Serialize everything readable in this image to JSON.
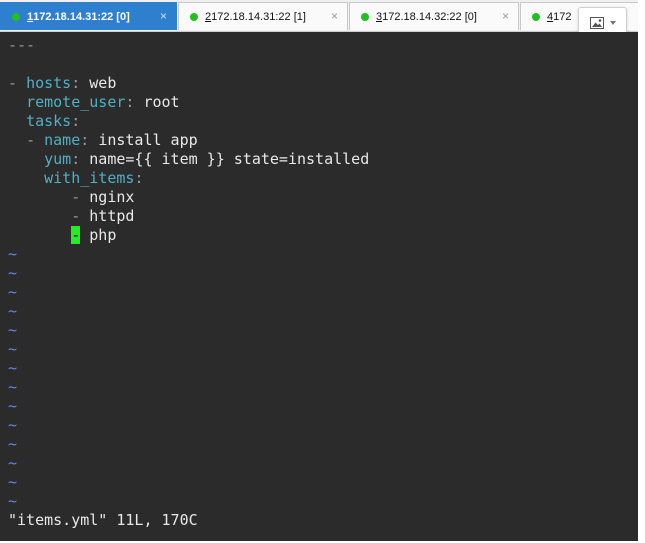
{
  "tabs": [
    {
      "num": "1",
      "label": " 172.18.14.31:22 [0]",
      "active": true,
      "close": "×"
    },
    {
      "num": "2",
      "label": " 172.18.14.31:22 [1]",
      "active": false,
      "close": "×"
    },
    {
      "num": "3",
      "label": " 172.18.14.32:22 [0]",
      "active": false,
      "close": "×"
    },
    {
      "num": "4",
      "label": " 172",
      "active": false,
      "close": ""
    }
  ],
  "media_button": {
    "icon": "image-icon"
  },
  "editor": {
    "lines": [
      {
        "parts": [
          {
            "t": "---",
            "c": "d"
          }
        ]
      },
      {
        "parts": []
      },
      {
        "parts": [
          {
            "t": "- ",
            "c": "d"
          },
          {
            "t": "hosts",
            "c": "k"
          },
          {
            "t": ": ",
            "c": "d"
          },
          {
            "t": "web",
            "c": "v"
          }
        ]
      },
      {
        "parts": [
          {
            "t": "  "
          },
          {
            "t": "remote_user",
            "c": "k"
          },
          {
            "t": ": ",
            "c": "d"
          },
          {
            "t": "root",
            "c": "v"
          }
        ]
      },
      {
        "parts": [
          {
            "t": "  "
          },
          {
            "t": "tasks",
            "c": "k"
          },
          {
            "t": ":",
            "c": "d"
          }
        ]
      },
      {
        "parts": [
          {
            "t": "  "
          },
          {
            "t": "- ",
            "c": "d"
          },
          {
            "t": "name",
            "c": "k"
          },
          {
            "t": ": ",
            "c": "d"
          },
          {
            "t": "install app",
            "c": "v"
          }
        ]
      },
      {
        "parts": [
          {
            "t": "    "
          },
          {
            "t": "yum",
            "c": "k"
          },
          {
            "t": ": ",
            "c": "d"
          },
          {
            "t": "name={{ item }} state=installed",
            "c": "v"
          }
        ]
      },
      {
        "parts": [
          {
            "t": "    "
          },
          {
            "t": "with_items",
            "c": "k"
          },
          {
            "t": ":",
            "c": "d"
          }
        ]
      },
      {
        "parts": [
          {
            "t": "       "
          },
          {
            "t": "- ",
            "c": "d"
          },
          {
            "t": "nginx",
            "c": "v"
          }
        ]
      },
      {
        "parts": [
          {
            "t": "       "
          },
          {
            "t": "- ",
            "c": "d"
          },
          {
            "t": "httpd",
            "c": "v"
          }
        ]
      },
      {
        "parts": [
          {
            "t": "       "
          },
          {
            "t": "-",
            "c": "cursor"
          },
          {
            "t": " "
          },
          {
            "t": "php",
            "c": "v"
          }
        ]
      }
    ],
    "tilde_char": "~",
    "tilde_count": 14,
    "status": "\"items.yml\" 11L, 170C"
  },
  "colors": {
    "terminal_bg": "#2b2b2b",
    "key": "#4fb0c6",
    "tilde": "#6b7ff2",
    "cursor": "#22ee22",
    "active_tab": "#2f7fcf",
    "status_dot": "#20c020"
  }
}
